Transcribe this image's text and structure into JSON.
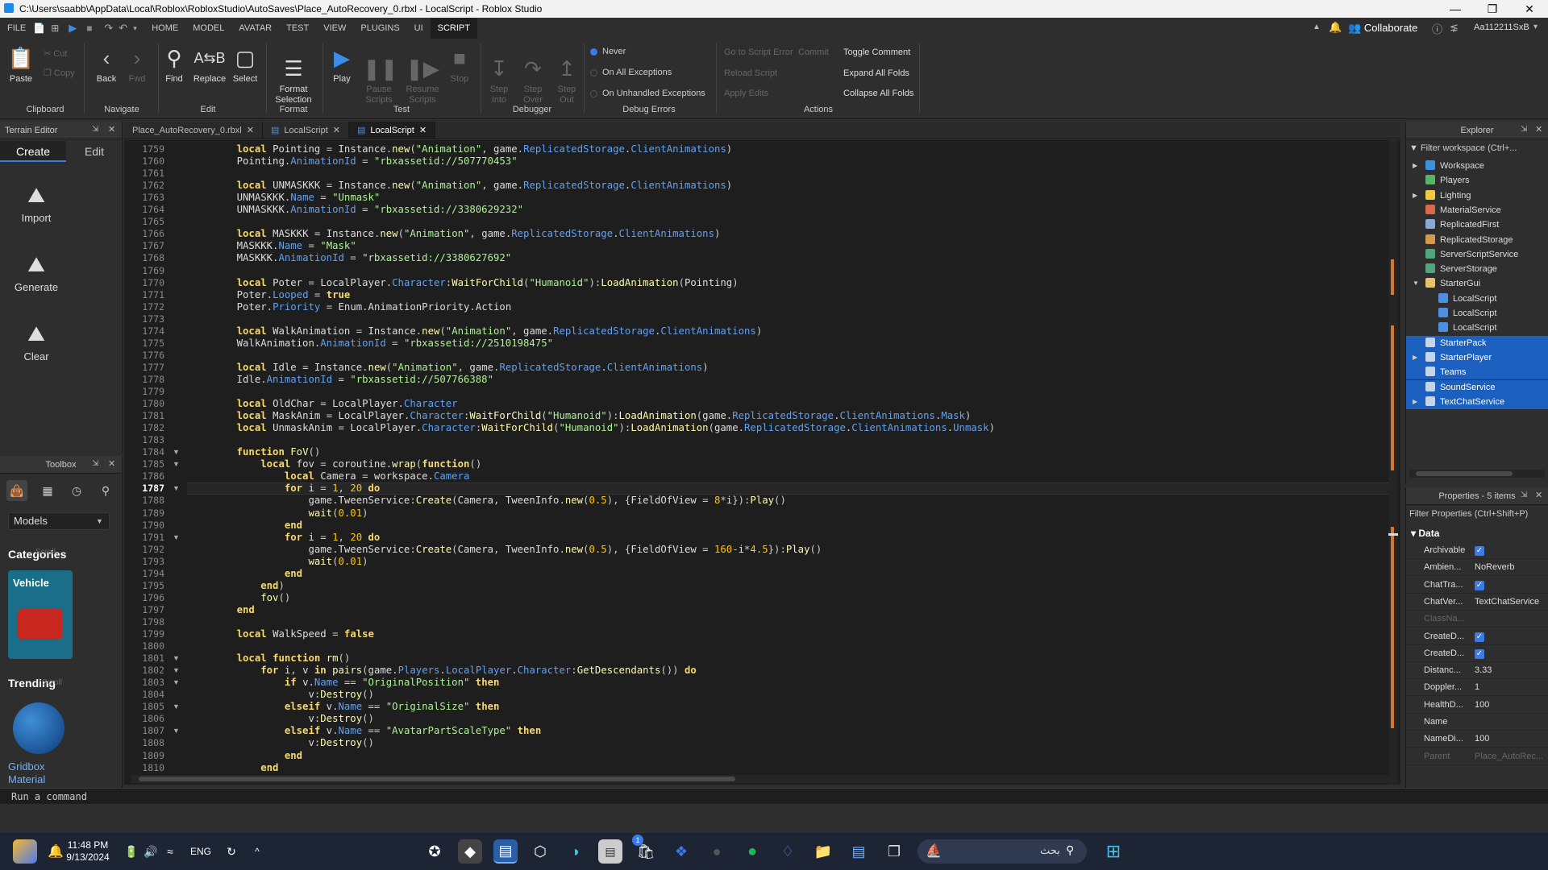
{
  "window": {
    "title": "C:\\Users\\saabb\\AppData\\Local\\Roblox\\RobloxStudio\\AutoSaves\\Place_AutoRecovery_0.rbxl - LocalScript - Roblox Studio"
  },
  "menu": [
    "FILE",
    "HOME",
    "MODEL",
    "AVATAR",
    "TEST",
    "VIEW",
    "PLUGINS",
    "UI",
    "SCRIPT"
  ],
  "menu_active": "SCRIPT",
  "topright": {
    "collaborate": "Collaborate",
    "user": "Aa112211SxB"
  },
  "ribbon": {
    "paste": "Paste",
    "cut": "Cut",
    "copy": "Copy",
    "clipboard": "Clipboard",
    "back": "Back",
    "fwd": "Fwd",
    "navigate": "Navigate",
    "find": "Find",
    "replace": "Replace",
    "select": "Select",
    "edit": "Edit",
    "format_selection": "Format\nSelection",
    "format": "Format",
    "play": "Play",
    "pause": "Pause\nScripts",
    "resume": "Resume\nScripts",
    "stop": "Stop",
    "test": "Test",
    "step_into": "Step\nInto",
    "step_over": "Step\nOver",
    "step_out": "Step\nOut",
    "debugger": "Debugger",
    "never": "Never",
    "on_all": "On All Exceptions",
    "on_unhandled": "On Unhandled Exceptions",
    "debug_errors": "Debug Errors",
    "go_to_error": "Go to Script Error",
    "commit": "Commit",
    "reload": "Reload Script",
    "apply": "Apply Edits",
    "toggle_comment": "Toggle Comment",
    "expand_folds": "Expand All Folds",
    "collapse_folds": "Collapse All Folds",
    "actions": "Actions"
  },
  "terrain": {
    "title": "Terrain Editor",
    "tab_create": "Create",
    "tab_edit": "Edit",
    "import": "Import",
    "generate": "Generate",
    "clear": "Clear"
  },
  "toolbox": {
    "title": "Toolbox",
    "models": "Models",
    "categories": "Categories",
    "vehicle": "Vehicle",
    "trending": "Trending",
    "gridbox": "Gridbox",
    "material": "Material",
    "scroll1": "Scroll",
    "scroll2": "Scroll"
  },
  "tabs": [
    "Place_AutoRecovery_0.rbxl",
    "LocalScript",
    "LocalScript"
  ],
  "editor": {
    "first_line": 1759,
    "current_line": 1787,
    "lines": [
      "    local Pointing = Instance.new(\"Animation\", game.ReplicatedStorage.ClientAnimations)",
      "    Pointing.AnimationId = \"rbxassetid://507770453\"",
      "",
      "    local UNMASKKK = Instance.new(\"Animation\", game.ReplicatedStorage.ClientAnimations)",
      "    UNMASKKK.Name = \"Unmask\"",
      "    UNMASKKK.AnimationId = \"rbxassetid://3380629232\"",
      "",
      "    local MASKKK = Instance.new(\"Animation\", game.ReplicatedStorage.ClientAnimations)",
      "    MASKKK.Name = \"Mask\"",
      "    MASKKK.AnimationId = \"rbxassetid://3380627692\"",
      "",
      "    local Poter = LocalPlayer.Character:WaitForChild(\"Humanoid\"):LoadAnimation(Pointing)",
      "    Poter.Looped = true",
      "    Poter.Priority = Enum.AnimationPriority.Action",
      "",
      "    local WalkAnimation = Instance.new(\"Animation\", game.ReplicatedStorage.ClientAnimations)",
      "    WalkAnimation.AnimationId = \"rbxassetid://2510198475\"",
      "",
      "    local Idle = Instance.new(\"Animation\", game.ReplicatedStorage.ClientAnimations)",
      "    Idle.AnimationId = \"rbxassetid://507766388\"",
      "",
      "    local OldChar = LocalPlayer.Character",
      "    local MaskAnim = LocalPlayer.Character:WaitForChild(\"Humanoid\"):LoadAnimation(game.ReplicatedStorage.ClientAnimations.Mask)",
      "    local UnmaskAnim = LocalPlayer.Character:WaitForChild(\"Humanoid\"):LoadAnimation(game.ReplicatedStorage.ClientAnimations.Unmask)",
      "",
      "    function FoV()",
      "        local fov = coroutine.wrap(function()",
      "            local Camera = workspace.Camera",
      "            for i = 1, 20 do",
      "                game.TweenService:Create(Camera, TweenInfo.new(0.5), {FieldOfView = 8*i}):Play()",
      "                wait(0.01)",
      "            end",
      "            for i = 1, 20 do",
      "                game.TweenService:Create(Camera, TweenInfo.new(0.5), {FieldOfView = 160-i*4.5}):Play()",
      "                wait(0.01)",
      "            end",
      "        end)",
      "        fov()",
      "    end",
      "",
      "    local WalkSpeed = false",
      "",
      "    local function rm()",
      "        for i, v in pairs(game.Players.LocalPlayer.Character:GetDescendants()) do",
      "            if v.Name == \"OriginalPosition\" then",
      "                v:Destroy()",
      "            elseif v.Name == \"OriginalSize\" then",
      "                v:Destroy()",
      "            elseif v.Name == \"AvatarPartScaleType\" then",
      "                v:Destroy()",
      "            end",
      "        end"
    ],
    "fold_lines": [
      1784,
      1785,
      1787,
      1791,
      1801,
      1802,
      1803,
      1805,
      1807
    ]
  },
  "command_bar": "Run a command",
  "explorer": {
    "title": "Explorer",
    "filter": "Filter workspace (Ctrl+...",
    "items": [
      {
        "label": "Workspace",
        "depth": 0,
        "arrow": "right",
        "icon": "#3d8fe0",
        "sel": false
      },
      {
        "label": "Players",
        "depth": 0,
        "arrow": "",
        "icon": "#59b368",
        "sel": false
      },
      {
        "label": "Lighting",
        "depth": 0,
        "arrow": "right",
        "icon": "#f2c744",
        "sel": false
      },
      {
        "label": "MaterialService",
        "depth": 0,
        "arrow": "",
        "icon": "#d9694b",
        "sel": false
      },
      {
        "label": "ReplicatedFirst",
        "depth": 0,
        "arrow": "",
        "icon": "#8aa9d6",
        "sel": false
      },
      {
        "label": "ReplicatedStorage",
        "depth": 0,
        "arrow": "",
        "icon": "#d39a4e",
        "sel": false
      },
      {
        "label": "ServerScriptService",
        "depth": 0,
        "arrow": "",
        "icon": "#4fa67a",
        "sel": false
      },
      {
        "label": "ServerStorage",
        "depth": 0,
        "arrow": "",
        "icon": "#4fa67a",
        "sel": false
      },
      {
        "label": "StarterGui",
        "depth": 0,
        "arrow": "down",
        "icon": "#e8c36a",
        "sel": false
      },
      {
        "label": "LocalScript",
        "depth": 1,
        "arrow": "",
        "icon": "#4d8fe0",
        "sel": false
      },
      {
        "label": "LocalScript",
        "depth": 1,
        "arrow": "",
        "icon": "#4d8fe0",
        "sel": false
      },
      {
        "label": "LocalScript",
        "depth": 1,
        "arrow": "",
        "icon": "#4d8fe0",
        "sel": false
      },
      {
        "label": "StarterPack",
        "depth": 0,
        "arrow": "",
        "icon": "#c6d4ea",
        "sel": true
      },
      {
        "label": "StarterPlayer",
        "depth": 0,
        "arrow": "right",
        "icon": "#c6d4ea",
        "sel": true
      },
      {
        "label": "Teams",
        "depth": 0,
        "arrow": "",
        "icon": "#c6d4ea",
        "sel": true
      },
      {
        "label": "SoundService",
        "depth": 0,
        "arrow": "",
        "icon": "#c6d4ea",
        "sel": true
      },
      {
        "label": "TextChatService",
        "depth": 0,
        "arrow": "right",
        "icon": "#c6d4ea",
        "sel": true
      }
    ]
  },
  "properties": {
    "title": "Properties - 5 items",
    "filter": "Filter Properties (Ctrl+Shift+P)",
    "section": "Data",
    "rows": [
      {
        "name": "Archivable",
        "value": "",
        "check": true,
        "dim": false
      },
      {
        "name": "Ambien...",
        "value": "NoReverb",
        "check": false,
        "dim": false
      },
      {
        "name": "ChatTra...",
        "value": "",
        "check": true,
        "dim": false
      },
      {
        "name": "ChatVer...",
        "value": "TextChatService",
        "check": false,
        "dim": false
      },
      {
        "name": "ClassNa...",
        "value": "",
        "check": false,
        "dim": true
      },
      {
        "name": "CreateD...",
        "value": "",
        "check": true,
        "dim": false
      },
      {
        "name": "CreateD...",
        "value": "",
        "check": true,
        "dim": false
      },
      {
        "name": "Distanc...",
        "value": "3.33",
        "check": false,
        "dim": false
      },
      {
        "name": "Doppler...",
        "value": "1",
        "check": false,
        "dim": false
      },
      {
        "name": "HealthD...",
        "value": "100",
        "check": false,
        "dim": false
      },
      {
        "name": "Name",
        "value": "",
        "check": false,
        "dim": false
      },
      {
        "name": "NameDi...",
        "value": "100",
        "check": false,
        "dim": false
      },
      {
        "name": "Parent",
        "value": "Place_AutoRec...",
        "check": false,
        "dim": true
      }
    ]
  },
  "taskbar": {
    "time": "11:48 PM",
    "date": "9/13/2024",
    "lang": "ENG",
    "search": "بحث",
    "badge": "1"
  }
}
